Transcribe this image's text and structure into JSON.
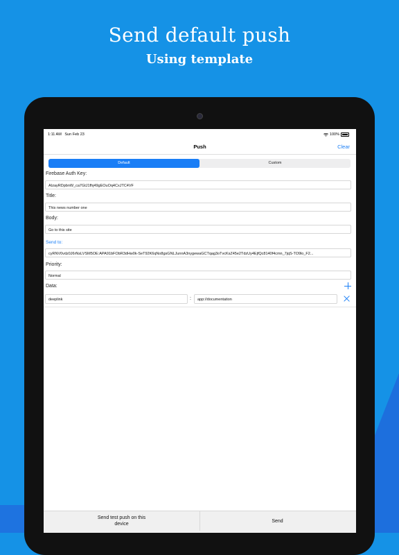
{
  "promo": {
    "headline": "Send default push",
    "subheadline": "Using template"
  },
  "status_bar": {
    "time": "1:11 AM",
    "date": "Sun Feb 23",
    "battery": "100%",
    "wifi_icon": "wifi-icon",
    "battery_icon": "battery-icon"
  },
  "nav": {
    "title": "Push",
    "clear_label": "Clear"
  },
  "segments": [
    {
      "label": "Default",
      "selected": true
    },
    {
      "label": "Custom",
      "selected": false
    }
  ],
  "form": {
    "firebase_label": "Firebase Auth Key:",
    "firebase_value": "AIzayRDpbnW_ca7GtJ1fhj49gEOuOq4CxJTC4VF",
    "title_label": "Title:",
    "title_value": "This news number one",
    "body_label": "Body:",
    "body_value": "Go to this site",
    "send_to_label": "Send to:",
    "send_to_value": "cyRNV0vdz0J6rNsLVSM5OE:APA91bFObR3dHw0k-SeT92K6qNo8gsGNLJunnA3nygewaGCTqag3oTvcKsZ45e2TdzUy4EjfQc8140f4cmn_7jqS-TO9lo_F2...",
    "priority_label": "Priority:",
    "priority_value": "Normal",
    "data_label": "Data:",
    "data_rows": [
      {
        "key": "deeplink",
        "value": "app://documentation"
      }
    ]
  },
  "bottom": {
    "test_push_label": "Send test push on this device",
    "send_label": "Send"
  },
  "colors": {
    "background": "#1592e6",
    "accent": "#1a7ef6"
  }
}
